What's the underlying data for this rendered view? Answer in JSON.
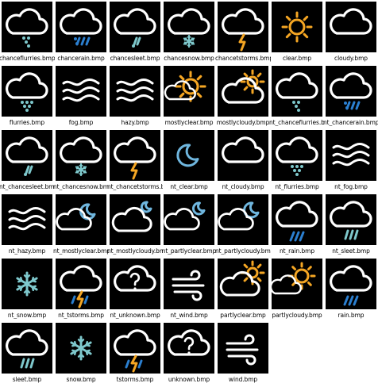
{
  "palette": {
    "background": "#ffffff",
    "tile": "#000000",
    "line": "#ffffff",
    "sun": "#f5a623",
    "teal": "#7ec8cc",
    "blue": "#2b7fd0",
    "moon": "#6fb6de"
  },
  "files": [
    {
      "name": "chanceflurries.bmp",
      "icon": "chance-flurries-icon"
    },
    {
      "name": "chancerain.bmp",
      "icon": "chance-rain-icon"
    },
    {
      "name": "chancesleet.bmp",
      "icon": "chance-sleet-icon"
    },
    {
      "name": "chancesnow.bmp",
      "icon": "chance-snow-icon"
    },
    {
      "name": "chancetstorms.bmp",
      "icon": "chance-tstorms-icon"
    },
    {
      "name": "clear.bmp",
      "icon": "clear-icon"
    },
    {
      "name": "cloudy.bmp",
      "icon": "cloudy-icon"
    },
    {
      "name": "flurries.bmp",
      "icon": "flurries-icon"
    },
    {
      "name": "fog.bmp",
      "icon": "fog-icon"
    },
    {
      "name": "hazy.bmp",
      "icon": "hazy-icon"
    },
    {
      "name": "mostlyclear.bmp",
      "icon": "mostly-clear-icon"
    },
    {
      "name": "mostlycloudy.bmp",
      "icon": "mostly-cloudy-icon"
    },
    {
      "name": "nt_chanceflurries.bmp",
      "icon": "nt-chance-flurries-icon"
    },
    {
      "name": "nt_chancerain.bmp",
      "icon": "nt-chance-rain-icon"
    },
    {
      "name": "nt_chancesleet.bmp",
      "icon": "nt-chance-sleet-icon"
    },
    {
      "name": "nt_chancesnow.bmp",
      "icon": "nt-chance-snow-icon"
    },
    {
      "name": "nt_chancetstorms.bmp",
      "icon": "nt-chance-tstorms-icon"
    },
    {
      "name": "nt_clear.bmp",
      "icon": "nt-clear-icon"
    },
    {
      "name": "nt_cloudy.bmp",
      "icon": "nt-cloudy-icon"
    },
    {
      "name": "nt_flurries.bmp",
      "icon": "nt-flurries-icon"
    },
    {
      "name": "nt_fog.bmp",
      "icon": "nt-fog-icon"
    },
    {
      "name": "nt_hazy.bmp",
      "icon": "nt-hazy-icon"
    },
    {
      "name": "nt_mostlyclear.bmp",
      "icon": "nt-mostly-clear-icon"
    },
    {
      "name": "nt_mostlycloudy.bmp",
      "icon": "nt-mostly-cloudy-icon"
    },
    {
      "name": "nt_partlyclear.bmp",
      "icon": "nt-partly-clear-icon"
    },
    {
      "name": "nt_partlycloudy.bmp",
      "icon": "nt-partly-cloudy-icon"
    },
    {
      "name": "nt_rain.bmp",
      "icon": "nt-rain-icon"
    },
    {
      "name": "nt_sleet.bmp",
      "icon": "nt-sleet-icon"
    },
    {
      "name": "nt_snow.bmp",
      "icon": "nt-snow-icon"
    },
    {
      "name": "nt_tstorms.bmp",
      "icon": "nt-tstorms-icon"
    },
    {
      "name": "nt_unknown.bmp",
      "icon": "nt-unknown-icon"
    },
    {
      "name": "nt_wind.bmp",
      "icon": "nt-wind-icon"
    },
    {
      "name": "partlyclear.bmp",
      "icon": "partly-clear-icon"
    },
    {
      "name": "partlycloudy.bmp",
      "icon": "partly-cloudy-icon"
    },
    {
      "name": "rain.bmp",
      "icon": "rain-icon"
    },
    {
      "name": "sleet.bmp",
      "icon": "sleet-icon"
    },
    {
      "name": "snow.bmp",
      "icon": "snow-icon"
    },
    {
      "name": "tstorms.bmp",
      "icon": "tstorms-icon"
    },
    {
      "name": "unknown.bmp",
      "icon": "unknown-icon"
    },
    {
      "name": "wind.bmp",
      "icon": "wind-icon"
    }
  ]
}
